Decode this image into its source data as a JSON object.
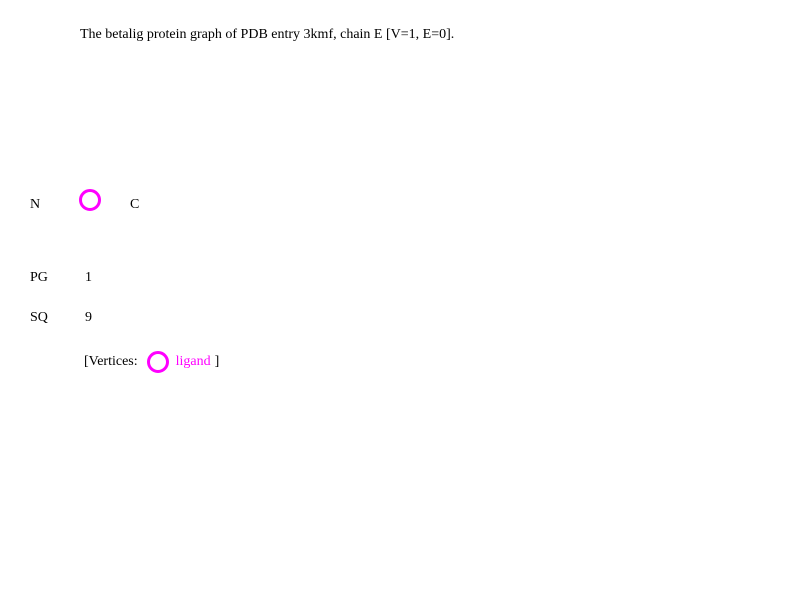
{
  "title": "The betalig protein graph of PDB entry 3kmf, chain E [V=1, E=0].",
  "graph": {
    "n_label": "N",
    "c_label": "C",
    "vertices": [
      {
        "type": "ligand",
        "color": "#ff00ff"
      }
    ]
  },
  "rows": {
    "pg": {
      "label": "PG",
      "value": "1"
    },
    "sq": {
      "label": "SQ",
      "value": "9"
    }
  },
  "legend": {
    "prefix": "[Vertices:",
    "ligand_label": "ligand",
    "suffix": "]",
    "ligand_color": "#ff00ff"
  }
}
